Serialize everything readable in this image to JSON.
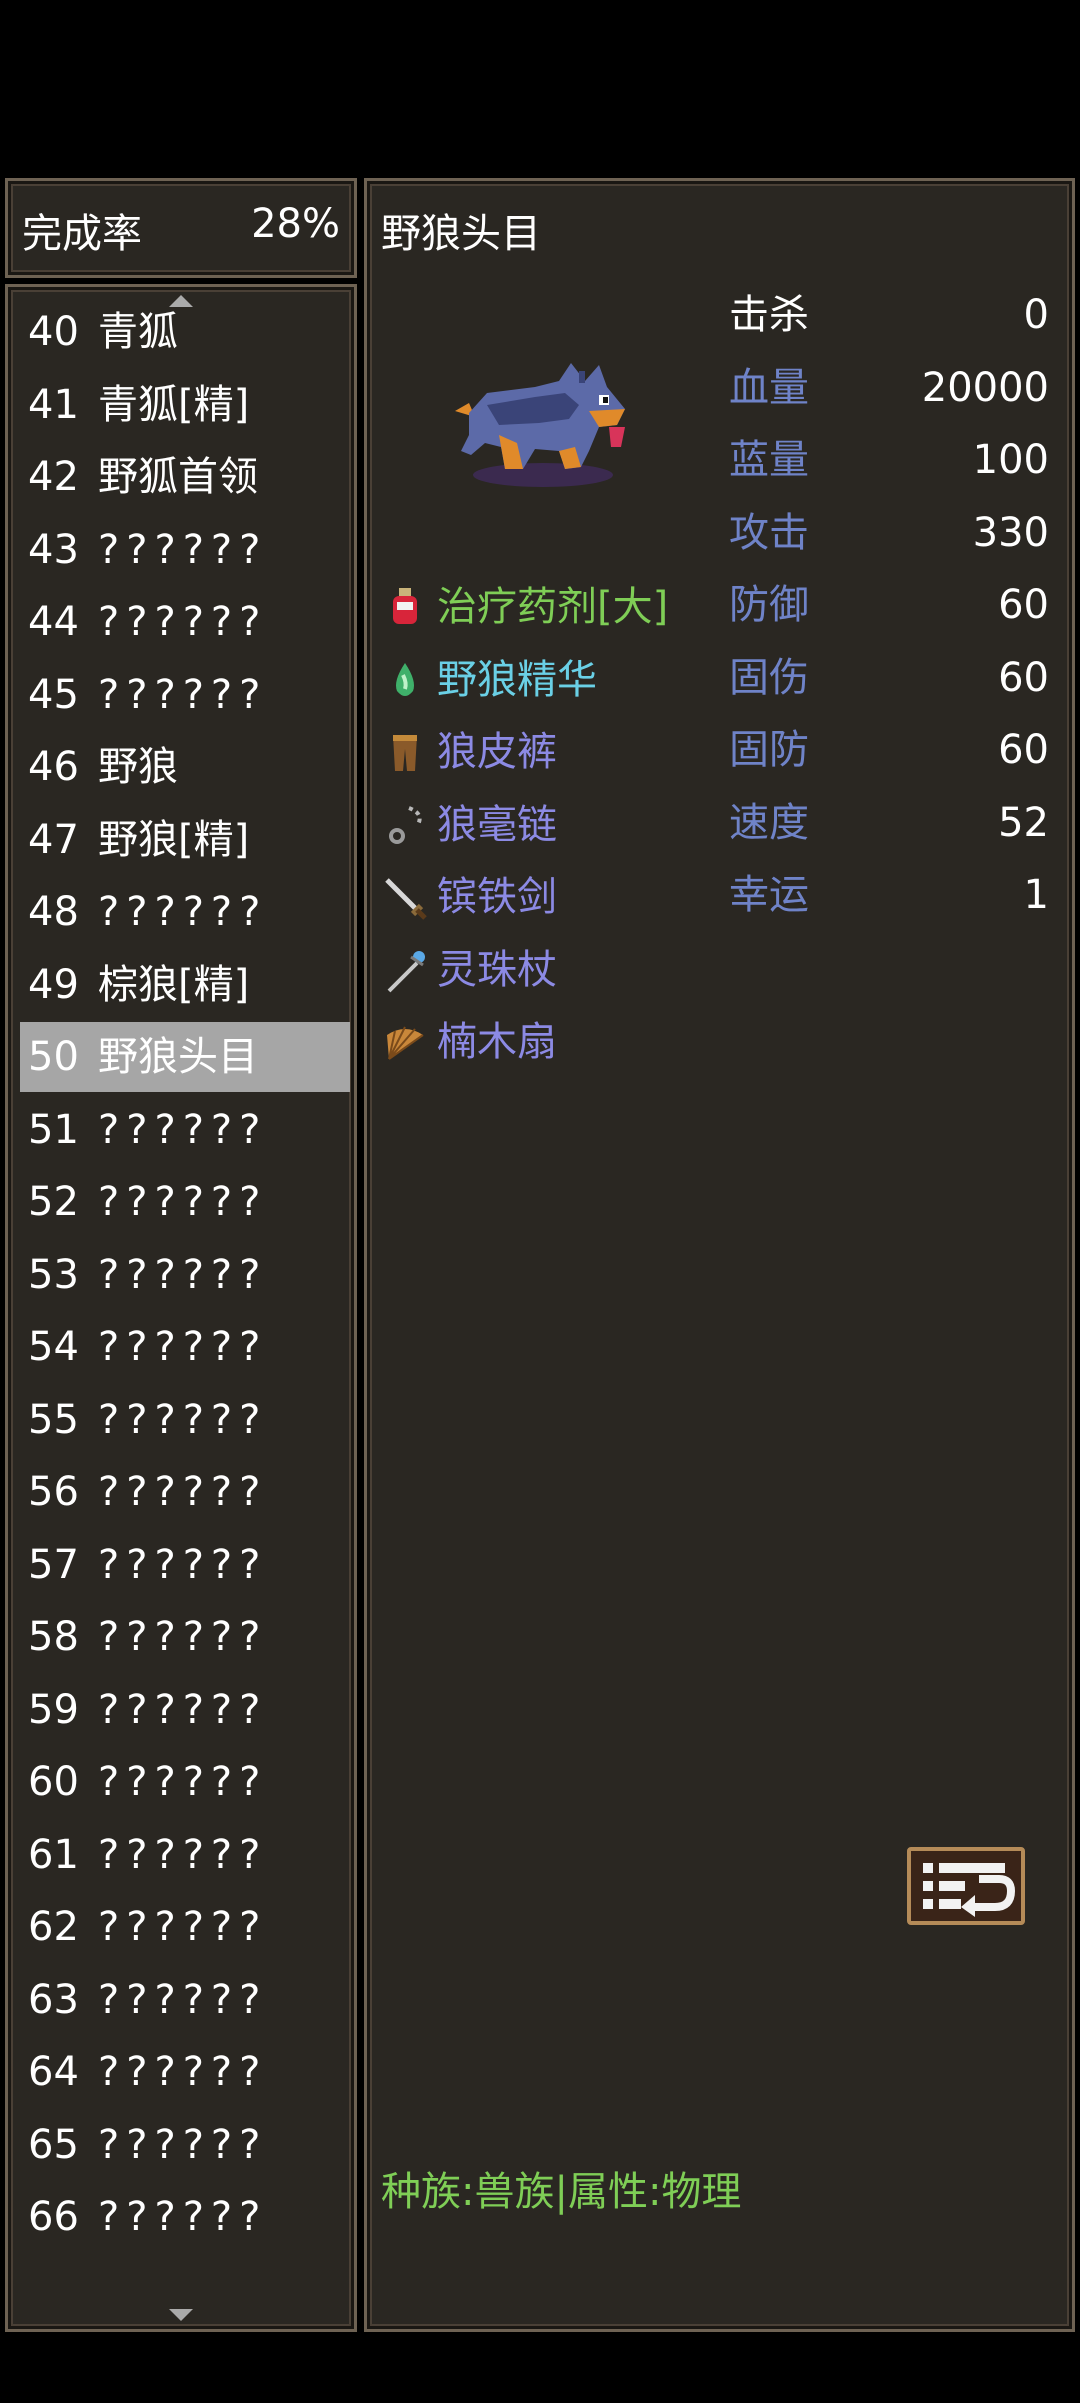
{
  "completion": {
    "label": "完成率",
    "value": "28%"
  },
  "list": [
    {
      "num": "40",
      "name": "青狐"
    },
    {
      "num": "41",
      "name": "青狐[精]"
    },
    {
      "num": "42",
      "name": "野狐首领"
    },
    {
      "num": "43",
      "name": "??????"
    },
    {
      "num": "44",
      "name": "??????"
    },
    {
      "num": "45",
      "name": "??????"
    },
    {
      "num": "46",
      "name": "野狼"
    },
    {
      "num": "47",
      "name": "野狼[精]"
    },
    {
      "num": "48",
      "name": "??????"
    },
    {
      "num": "49",
      "name": "棕狼[精]"
    },
    {
      "num": "50",
      "name": "野狼头目",
      "selected": true
    },
    {
      "num": "51",
      "name": "??????"
    },
    {
      "num": "52",
      "name": "??????"
    },
    {
      "num": "53",
      "name": "??????"
    },
    {
      "num": "54",
      "name": "??????"
    },
    {
      "num": "55",
      "name": "??????"
    },
    {
      "num": "56",
      "name": "??????"
    },
    {
      "num": "57",
      "name": "??????"
    },
    {
      "num": "58",
      "name": "??????"
    },
    {
      "num": "59",
      "name": "??????"
    },
    {
      "num": "60",
      "name": "??????"
    },
    {
      "num": "61",
      "name": "??????"
    },
    {
      "num": "62",
      "name": "??????"
    },
    {
      "num": "63",
      "name": "??????"
    },
    {
      "num": "64",
      "name": "??????"
    },
    {
      "num": "65",
      "name": "??????"
    },
    {
      "num": "66",
      "name": "??????"
    }
  ],
  "detail": {
    "title": "野狼头目",
    "sprite": "wolf-chief-sprite",
    "stats": [
      {
        "label": "击杀",
        "value": "0",
        "kind": "kill"
      },
      {
        "label": "血量",
        "value": "20000",
        "kind": "blue"
      },
      {
        "label": "蓝量",
        "value": "100",
        "kind": "blue"
      },
      {
        "label": "攻击",
        "value": "330",
        "kind": "blue"
      },
      {
        "label": "防御",
        "value": "60",
        "kind": "blue"
      },
      {
        "label": "固伤",
        "value": "60",
        "kind": "blue"
      },
      {
        "label": "固防",
        "value": "60",
        "kind": "blue"
      },
      {
        "label": "速度",
        "value": "52",
        "kind": "blue"
      },
      {
        "label": "幸运",
        "value": "1",
        "kind": "blue"
      }
    ],
    "drops": [
      {
        "name": "治疗药剂[大]",
        "icon": "red-potion-icon",
        "color": "#7fce56"
      },
      {
        "name": "野狼精华",
        "icon": "green-essence-icon",
        "color": "#6ad0e6"
      },
      {
        "name": "狼皮裤",
        "icon": "leather-pants-icon",
        "color": "#8c8ae4"
      },
      {
        "name": "狼毫链",
        "icon": "chain-necklace-icon",
        "color": "#8c8ae4"
      },
      {
        "name": "镔铁剑",
        "icon": "sword-icon",
        "color": "#8c8ae4"
      },
      {
        "name": "灵珠杖",
        "icon": "staff-icon",
        "color": "#8c8ae4"
      },
      {
        "name": "楠木扇",
        "icon": "fan-icon",
        "color": "#8c8ae4"
      }
    ],
    "return_icon": "return-icon",
    "race_info": "种族:兽族|属性:物理"
  }
}
